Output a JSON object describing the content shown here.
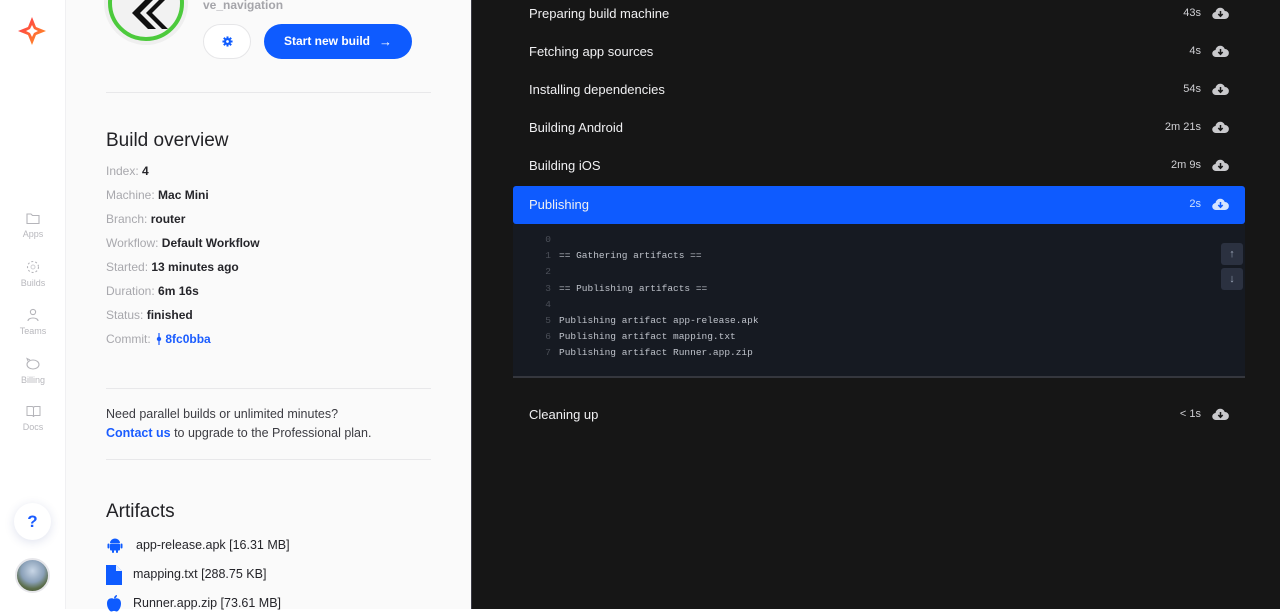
{
  "nav": {
    "items": [
      {
        "label": "Apps",
        "icon": "folder-icon"
      },
      {
        "label": "Builds",
        "icon": "builds-icon"
      },
      {
        "label": "Teams",
        "icon": "user-icon"
      },
      {
        "label": "Billing",
        "icon": "piggy-bank-icon"
      },
      {
        "label": "Docs",
        "icon": "book-icon"
      }
    ],
    "help_label": "?"
  },
  "app": {
    "name": "ve_navigation",
    "start_build_label": "Start new build",
    "start_build_arrow": "→"
  },
  "overview": {
    "title": "Build overview",
    "fields": [
      {
        "key": "Index:",
        "value": "4"
      },
      {
        "key": "Machine:",
        "value": "Mac Mini"
      },
      {
        "key": "Branch:",
        "value": "router"
      },
      {
        "key": "Workflow:",
        "value": "Default Workflow"
      },
      {
        "key": "Started:",
        "value": "13 minutes ago"
      },
      {
        "key": "Duration:",
        "value": "6m 16s"
      },
      {
        "key": "Status:",
        "value": "finished"
      },
      {
        "key": "Commit:",
        "value": "8fc0bba"
      }
    ]
  },
  "promo": {
    "line1": "Need parallel builds or unlimited minutes?",
    "link": "Contact us",
    "line2": " to upgrade to the Professional plan."
  },
  "artifacts": {
    "title": "Artifacts",
    "items": [
      {
        "name": "app-release.apk [16.31 MB]",
        "icon": "android-icon"
      },
      {
        "name": "mapping.txt [288.75 KB]",
        "icon": "file-icon"
      },
      {
        "name": "Runner.app.zip [73.61 MB]",
        "icon": "apple-icon"
      }
    ]
  },
  "steps": [
    {
      "label": "Preparing build machine",
      "duration": "43s"
    },
    {
      "label": "Fetching app sources",
      "duration": "4s"
    },
    {
      "label": "Installing dependencies",
      "duration": "54s"
    },
    {
      "label": "Building Android",
      "duration": "2m 21s"
    },
    {
      "label": "Building iOS",
      "duration": "2m 9s"
    },
    {
      "label": "Publishing",
      "duration": "2s",
      "active": true
    },
    {
      "label": "Cleaning up",
      "duration": "< 1s"
    }
  ],
  "log": {
    "lines": [
      {
        "n": "0",
        "text": ""
      },
      {
        "n": "1",
        "text": "== Gathering artifacts =="
      },
      {
        "n": "2",
        "text": ""
      },
      {
        "n": "3",
        "text": "== Publishing artifacts =="
      },
      {
        "n": "4",
        "text": ""
      },
      {
        "n": "5",
        "text": "Publishing artifact app-release.apk"
      },
      {
        "n": "6",
        "text": "Publishing artifact mapping.txt"
      },
      {
        "n": "7",
        "text": "Publishing artifact Runner.app.zip"
      }
    ],
    "scroll_up": "↑",
    "scroll_down": "↓"
  },
  "colors": {
    "accent": "#0e5bff",
    "dark_bg": "#161616",
    "log_bg": "#161a22",
    "app_ring": "#4cca3c"
  }
}
